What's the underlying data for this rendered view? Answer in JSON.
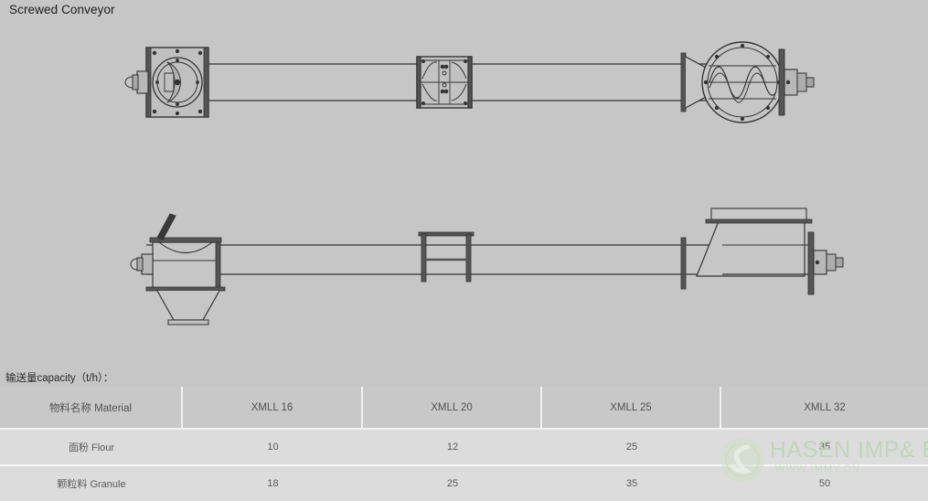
{
  "page": {
    "title": "Screwed Conveyor",
    "background_color": "#c6c6c6"
  },
  "capacity": {
    "caption": "输送量capacity（t/h）："
  },
  "table": {
    "headers": [
      "物料名称 Material",
      "XMLL 16",
      "XMLL 20",
      "XMLL 25",
      "XMLL 32"
    ],
    "rows": [
      {
        "material": "面粉 Flour",
        "values": [
          "10",
          "12",
          "25",
          "35"
        ]
      },
      {
        "material": "颗粒料 Granule",
        "values": [
          "18",
          "25",
          "35",
          "50"
        ]
      }
    ],
    "header_bg": "#c8c8c8",
    "row_bg": "#dcdcdc",
    "text_color": "#5a5a5a"
  },
  "drawings": {
    "top_view": {
      "name": "screw-conveyor-plan-view",
      "features": [
        "drive-motor-housing",
        "gearbox-flange",
        "conveyor-trough",
        "center-inspection-hatch",
        "discharge-housing-with-screw",
        "end-bearing"
      ]
    },
    "side_view": {
      "name": "screw-conveyor-elevation-view",
      "features": [
        "inlet-hopper",
        "hopper-lid",
        "discharge-cone",
        "conveyor-trough",
        "center-support-frame",
        "outlet-chute",
        "end-bearing"
      ]
    },
    "line_color": "#333333",
    "fill_color": "#c6c6c6"
  },
  "watermark": {
    "text": "HASEN IMP& EXP",
    "subtext": "WWW.IMMY.CN",
    "color": "#bcd4b4",
    "logo_name": "hasen-circle-logo"
  }
}
